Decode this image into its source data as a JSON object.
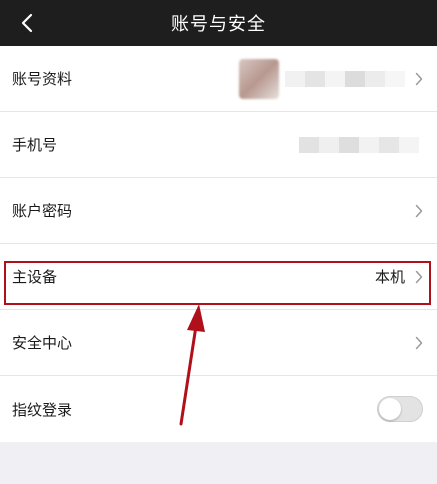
{
  "navbar": {
    "back_icon": "chevron-left-icon",
    "title": "账号与安全"
  },
  "rows": [
    {
      "label": "账号资料",
      "value": "",
      "accessory": "chevron",
      "value_obscured": true
    },
    {
      "label": "手机号",
      "value": "",
      "accessory": "none",
      "value_obscured": true
    },
    {
      "label": "账户密码",
      "value": "",
      "accessory": "chevron"
    },
    {
      "label": "主设备",
      "value": "本机",
      "accessory": "chevron",
      "highlighted": true
    },
    {
      "label": "安全中心",
      "value": "",
      "accessory": "chevron"
    },
    {
      "label": "指纹登录",
      "value": "",
      "accessory": "toggle",
      "toggle_on": false
    }
  ],
  "annotation": {
    "color": "#b0101a"
  },
  "colors": {
    "navbar_bg": "#1e1e1e",
    "page_bg": "#efeff4",
    "row_bg": "#ffffff"
  }
}
